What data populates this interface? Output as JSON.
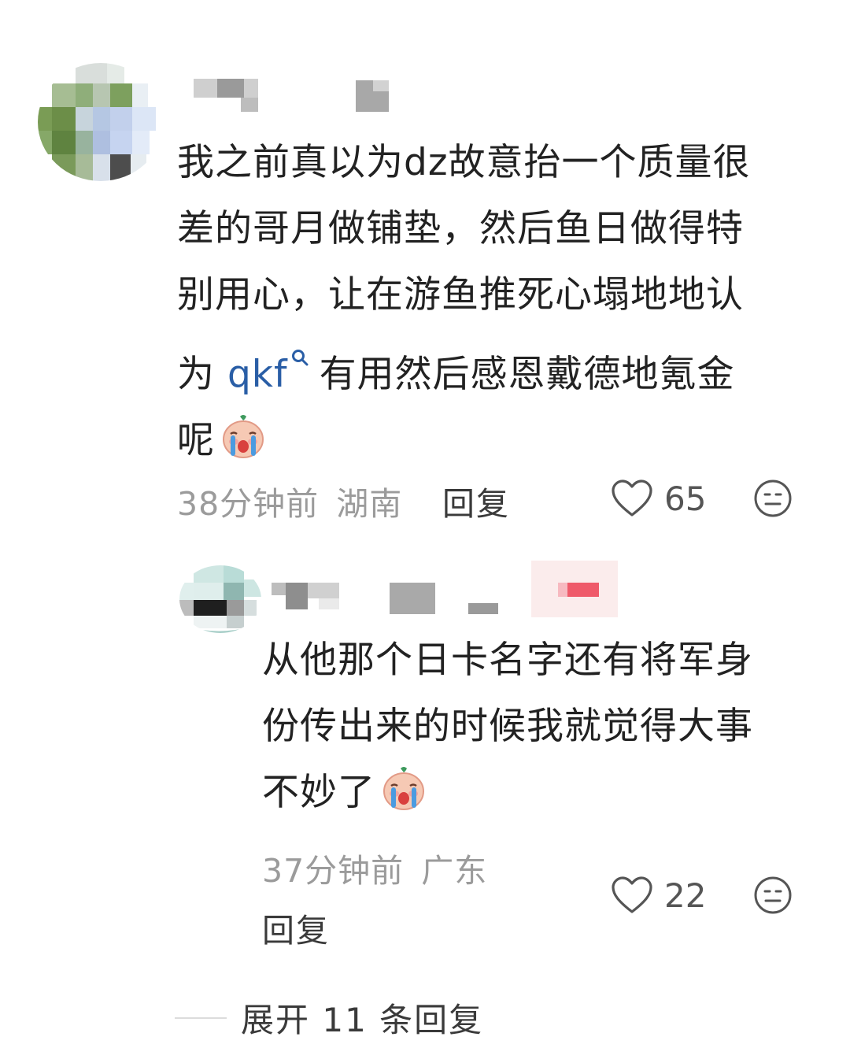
{
  "comment": {
    "text_lines": [
      "我之前真以为dz故意抬一个质量很",
      "差的哥月做铺垫，然后鱼日做得特",
      "别用心，让在游鱼推死心塌地地认"
    ],
    "line4_prefix": "为 ",
    "link_label": "qkf",
    "line4_suffix": "有用然后感恩戴德地氪金",
    "line5": "呢",
    "time": "38分钟前",
    "location": "湖南",
    "reply_label": "回复",
    "likes": "65"
  },
  "reply": {
    "text_lines": [
      "从他那个日卡名字还有将军身",
      "份传出来的时候我就觉得大事"
    ],
    "line3": "不妙了",
    "time": "37分钟前",
    "location": "广东",
    "reply_label": "回复",
    "likes": "22"
  },
  "expand": {
    "label": "展开 11 条回复"
  },
  "icons": {
    "like": "heart-outline-icon",
    "dislike": "meh-face-icon",
    "emoji": "crying-face-emoji",
    "search": "search-icon"
  },
  "colors": {
    "link": "#2a5ea6",
    "text": "#222222",
    "meta": "#9b9b9b"
  }
}
